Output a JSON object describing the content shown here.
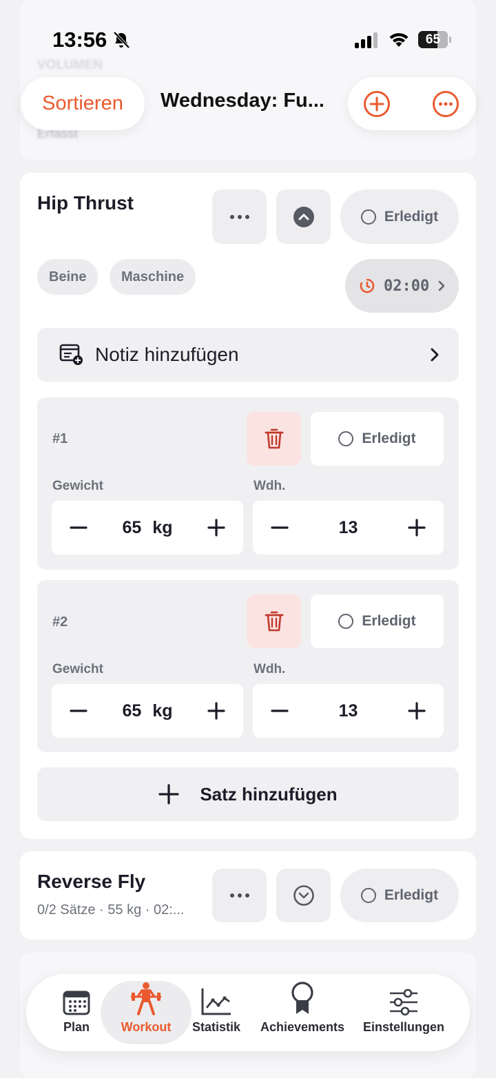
{
  "status": {
    "time": "13:56",
    "battery": "65"
  },
  "background": {
    "label_top": "VOLUMEN",
    "label_erfasst": "Erfasst"
  },
  "topbar": {
    "sort_label": "Sortieren",
    "title": "Wednesday: Fu..."
  },
  "exercise1": {
    "title": "Hip Thrust",
    "done_label": "Erledigt",
    "tags": [
      "Beine",
      "Maschine"
    ],
    "timer": "02:00",
    "note_label": "Notiz hinzufügen",
    "sets": [
      {
        "number": "#1",
        "done_label": "Erledigt",
        "weight_label": "Gewicht",
        "weight": "65",
        "unit": "kg",
        "reps_label": "Wdh.",
        "reps": "13"
      },
      {
        "number": "#2",
        "done_label": "Erledigt",
        "weight_label": "Gewicht",
        "weight": "65",
        "unit": "kg",
        "reps_label": "Wdh.",
        "reps": "13"
      }
    ],
    "add_set_label": "Satz hinzufügen"
  },
  "exercise2": {
    "title": "Reverse Fly",
    "subtitle": "0/2 Sätze · 55 kg · 02:...",
    "done_label": "Erledigt"
  },
  "tabs": [
    {
      "label": "Plan",
      "icon": "calendar-icon"
    },
    {
      "label": "Workout",
      "icon": "weightlifter-icon",
      "active": true
    },
    {
      "label": "Statistik",
      "icon": "chart-line-icon"
    },
    {
      "label": "Achievements",
      "icon": "award-icon"
    },
    {
      "label": "Einstellungen",
      "icon": "sliders-icon"
    }
  ],
  "colors": {
    "accent": "#ea5a2e",
    "danger": "#c0392b",
    "background": "#f2f2f4"
  }
}
